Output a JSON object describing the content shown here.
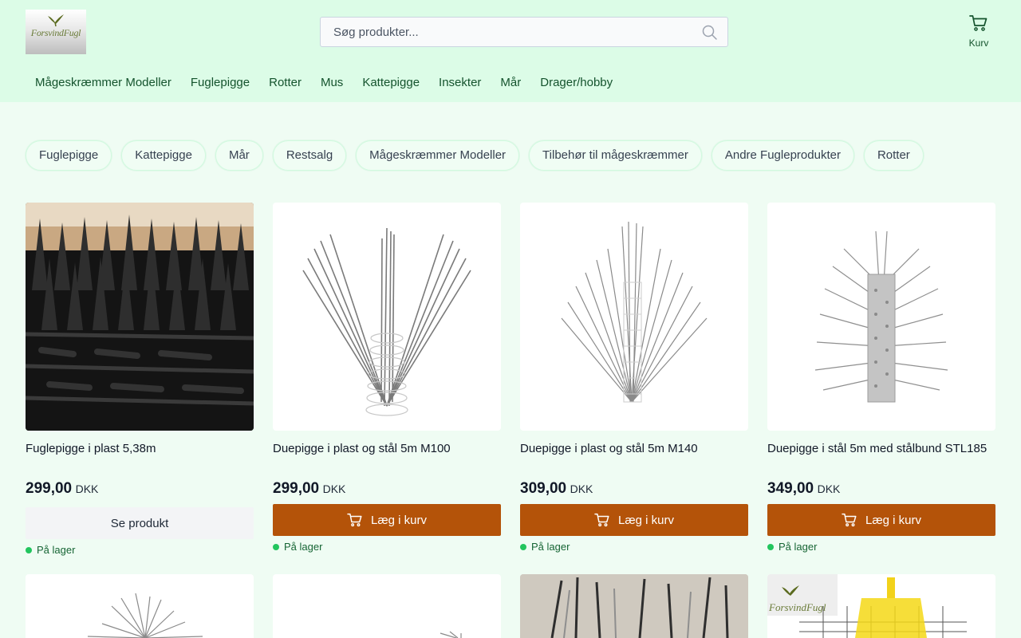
{
  "header": {
    "logo_text": "ForsvindFugl",
    "search_placeholder": "Søg produkter...",
    "cart_label": "Kurv"
  },
  "nav": [
    {
      "label": "Mågeskræmmer Modeller"
    },
    {
      "label": "Fuglepigge"
    },
    {
      "label": "Rotter"
    },
    {
      "label": "Mus"
    },
    {
      "label": "Kattepigge"
    },
    {
      "label": "Insekter"
    },
    {
      "label": "Mår"
    },
    {
      "label": "Drager/hobby"
    }
  ],
  "categories": [
    {
      "label": "Fuglepigge"
    },
    {
      "label": "Kattepigge"
    },
    {
      "label": "Mår"
    },
    {
      "label": "Restsalg"
    },
    {
      "label": "Mågeskræmmer Modeller"
    },
    {
      "label": "Tilbehør til mågeskræmmer"
    },
    {
      "label": "Andre Fugleprodukter"
    },
    {
      "label": "Rotter"
    }
  ],
  "products": [
    {
      "name": "Fuglepigge i plast 5,38m",
      "price": "299,00",
      "currency": "DKK",
      "button": "Se produkt",
      "stock": "På lager"
    },
    {
      "name": "Duepigge i plast og stål 5m M100",
      "price": "299,00",
      "currency": "DKK",
      "button": "Læg i kurv",
      "stock": "På lager"
    },
    {
      "name": "Duepigge i plast og stål 5m M140",
      "price": "309,00",
      "currency": "DKK",
      "button": "Læg i kurv",
      "stock": "På lager"
    },
    {
      "name": "Duepigge i stål 5m med stålbund STL185",
      "price": "349,00",
      "currency": "DKK",
      "button": "Læg i kurv",
      "stock": "På lager"
    }
  ],
  "row2_logo_text": "ForsvindFugl",
  "colors": {
    "header_bg": "#dcfce7",
    "page_bg": "#effcf3",
    "accent": "#b45309",
    "stock_dot": "#22c55e",
    "nav_text": "#14532d"
  }
}
